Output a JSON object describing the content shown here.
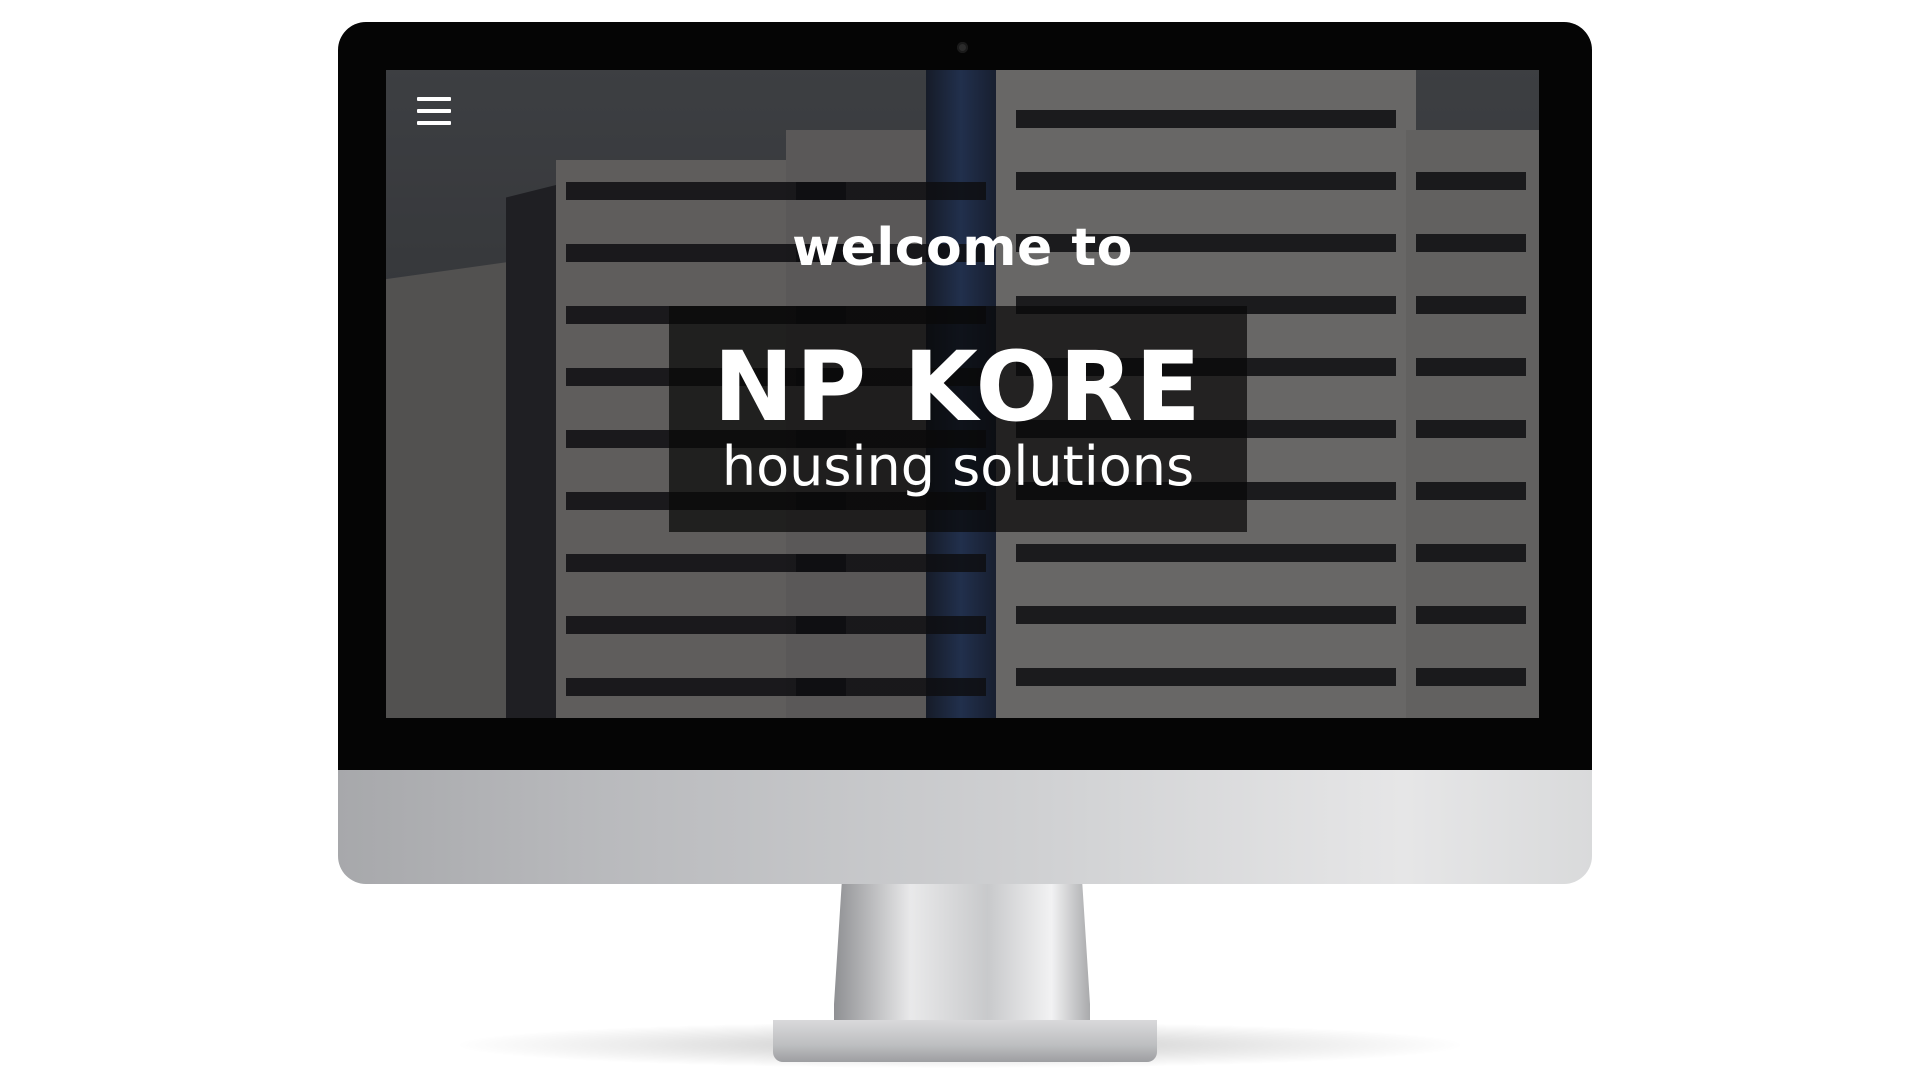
{
  "hero": {
    "welcome_text": "welcome to",
    "brand_name": "NP KORE",
    "tagline": "housing solutions"
  },
  "nav": {
    "menu_icon": "hamburger-menu-icon"
  },
  "colors": {
    "bezel": "#050505",
    "text": "#ffffff",
    "title_box": "#080808"
  }
}
